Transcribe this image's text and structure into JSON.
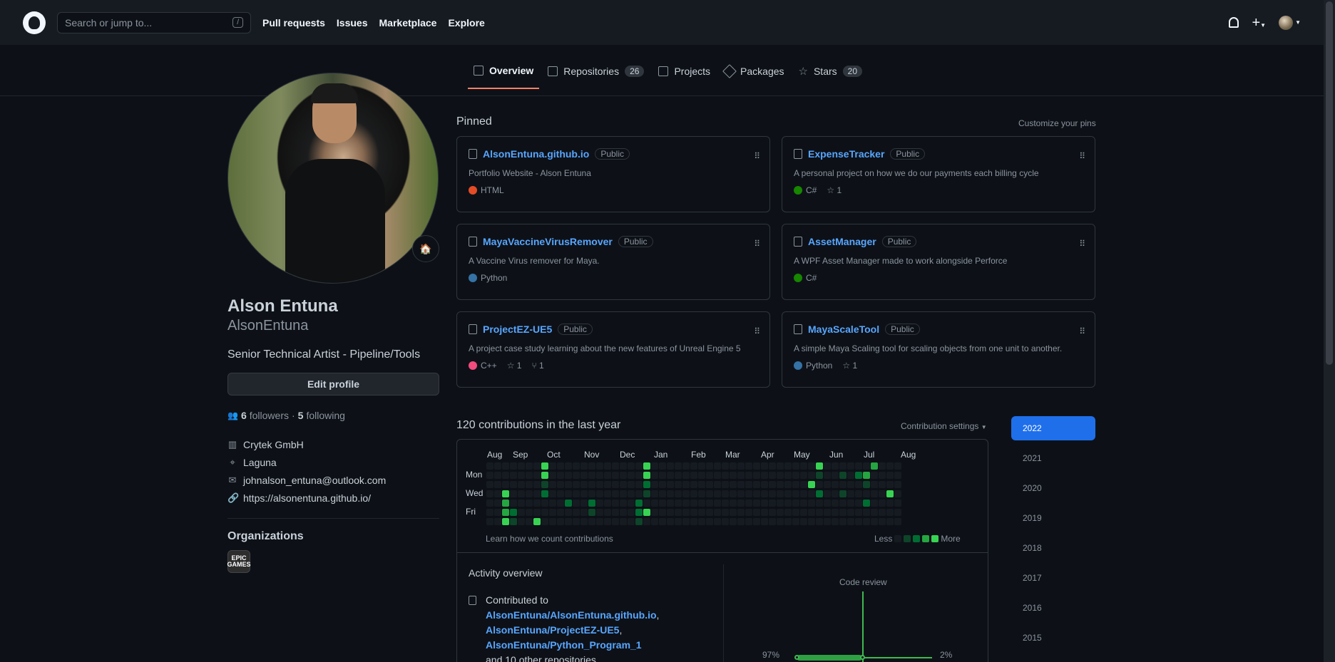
{
  "header": {
    "search_placeholder": "Search or jump to...",
    "search_key": "/",
    "nav": [
      "Pull requests",
      "Issues",
      "Marketplace",
      "Explore"
    ]
  },
  "tabs": [
    {
      "label": "Overview",
      "count": null,
      "active": true
    },
    {
      "label": "Repositories",
      "count": "26"
    },
    {
      "label": "Projects",
      "count": null
    },
    {
      "label": "Packages",
      "count": null
    },
    {
      "label": "Stars",
      "count": "20"
    }
  ],
  "profile": {
    "name": "Alson Entuna",
    "login": "AlsonEntuna",
    "bio": "Senior Technical Artist - Pipeline/Tools",
    "edit_label": "Edit profile",
    "followers": "6",
    "followers_label": "followers",
    "following": "5",
    "following_label": "following",
    "company": "Crytek GmbH",
    "location": "Laguna",
    "email": "johnalson_entuna@outlook.com",
    "website": "https://alsonentuna.github.io/",
    "orgs_heading": "Organizations",
    "org_logo_text": "EPIC\nGAMES"
  },
  "pinned": {
    "heading": "Pinned",
    "customize": "Customize your pins",
    "repos": [
      {
        "name": "AlsonEntuna.github.io",
        "visibility": "Public",
        "desc": "Portfolio Website - Alson Entuna",
        "lang": "HTML",
        "lang_color": "#e34c26",
        "stars": null,
        "forks": null
      },
      {
        "name": "ExpenseTracker",
        "visibility": "Public",
        "desc": "A personal project on how we do our payments each billing cycle",
        "lang": "C#",
        "lang_color": "#178600",
        "stars": "1",
        "forks": null
      },
      {
        "name": "MayaVaccineVirusRemover",
        "visibility": "Public",
        "desc": "A Vaccine Virus remover for Maya.",
        "lang": "Python",
        "lang_color": "#3572A5",
        "stars": null,
        "forks": null
      },
      {
        "name": "AssetManager",
        "visibility": "Public",
        "desc": "A WPF Asset Manager made to work alongside Perforce",
        "lang": "C#",
        "lang_color": "#178600",
        "stars": null,
        "forks": null
      },
      {
        "name": "ProjectEZ-UE5",
        "visibility": "Public",
        "desc": "A project case study learning about the new features of Unreal Engine 5",
        "lang": "C++",
        "lang_color": "#f34b7d",
        "stars": "1",
        "forks": "1"
      },
      {
        "name": "MayaScaleTool",
        "visibility": "Public",
        "desc": "A simple Maya Scaling tool for scaling objects from one unit to another.",
        "lang": "Python",
        "lang_color": "#3572A5",
        "stars": "1",
        "forks": null
      }
    ]
  },
  "contributions": {
    "heading": "120 contributions in the last year",
    "settings": "Contribution settings",
    "months": [
      "Aug",
      "Sep",
      "Oct",
      "Nov",
      "Dec",
      "Jan",
      "Feb",
      "Mar",
      "Apr",
      "May",
      "Jun",
      "Jul",
      "Aug"
    ],
    "days": [
      "Mon",
      "Wed",
      "Fri"
    ],
    "learn": "Learn how we count contributions",
    "less": "Less",
    "more": "More",
    "colors": [
      "#161b22",
      "#0e4429",
      "#006d32",
      "#26a641",
      "#39d353"
    ]
  },
  "activity": {
    "heading": "Activity overview",
    "contributed_to": "Contributed to",
    "repos": [
      "AlsonEntuna/AlsonEntuna.github.io",
      "AlsonEntuna/ProjectEZ-UE5",
      "AlsonEntuna/Python_Program_1"
    ],
    "others": "and 10 other repositories",
    "code_review": "Code review",
    "left_pct": "97%",
    "right_pct": "2%"
  },
  "years": [
    "2022",
    "2021",
    "2020",
    "2019",
    "2018",
    "2017",
    "2016",
    "2015"
  ],
  "active_year": "2022"
}
